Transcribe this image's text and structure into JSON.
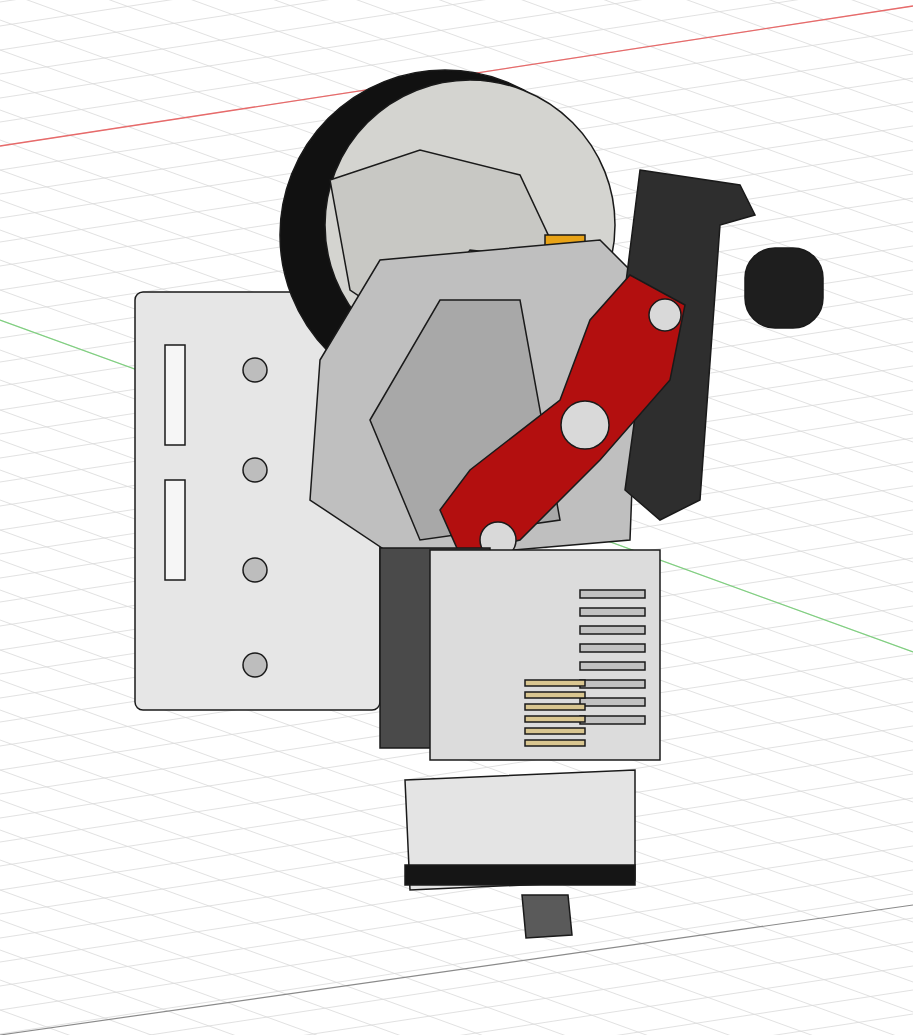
{
  "viewport": {
    "axes": [
      {
        "kind": "x",
        "color": "#e86a6a"
      },
      {
        "kind": "y",
        "color": "#7fd07f"
      }
    ]
  }
}
